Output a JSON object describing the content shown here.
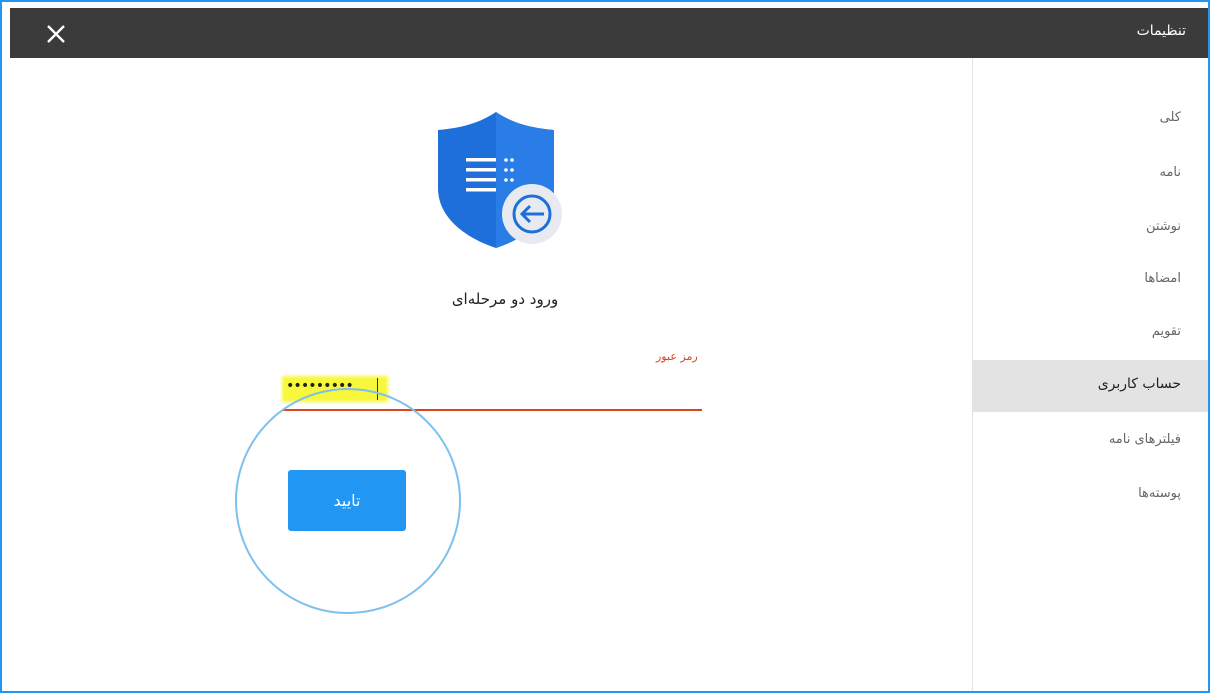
{
  "window": {
    "title": "تنظیمات",
    "close_icon": "close-icon"
  },
  "sidebar": {
    "items": [
      {
        "label": "کلی"
      },
      {
        "label": "نامه"
      },
      {
        "label": "نوشتن"
      },
      {
        "label": "امضاها"
      },
      {
        "label": "تقویم"
      },
      {
        "label": "حساب کاربری",
        "active": true
      },
      {
        "label": "فیلترهای نامه"
      },
      {
        "label": "پوسته‌ها"
      }
    ]
  },
  "main": {
    "icon": "shield-login-icon",
    "heading": "ورود دو مرحله‌ای",
    "password": {
      "label": "رمز عبور",
      "masked_value": "•••••••••"
    },
    "confirm_label": "تایید"
  },
  "colors": {
    "accent": "#2196f3",
    "titlebar": "#3b3b3b",
    "error_red": "#d9431d",
    "shield_blue": "#1e6fd9",
    "highlight_yellow": "#f7f731"
  }
}
